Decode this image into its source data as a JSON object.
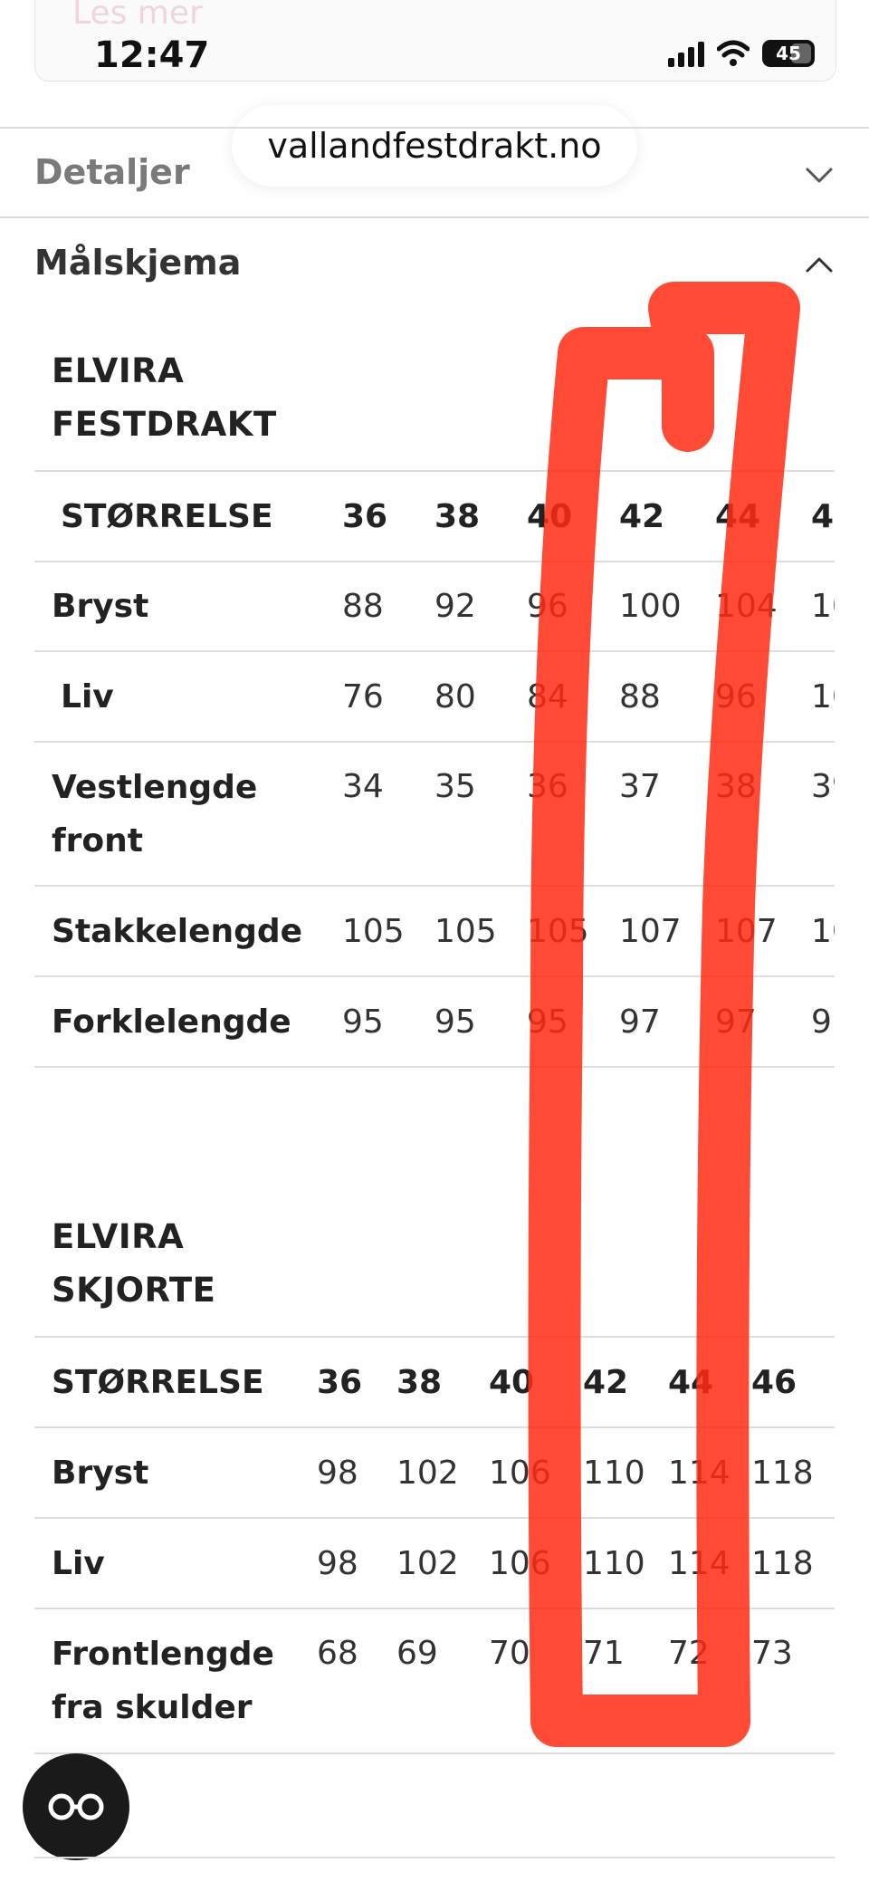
{
  "top": {
    "les_mer": "Les mer"
  },
  "status_bar": {
    "time": "12:47",
    "battery": "45"
  },
  "browser": {
    "url": "vallandfestdrakt.no"
  },
  "accordion": {
    "details_label": "Detaljer",
    "size_chart_label": "Målskjema"
  },
  "festdrakt_table": {
    "title_line1": "ELVIRA",
    "title_line2": "FESTDRAKT",
    "header": [
      "STØRRELSE",
      "36",
      "38",
      "40",
      "42",
      "44",
      "4"
    ],
    "rows": [
      {
        "label": "Bryst",
        "values": [
          "88",
          "92",
          "96",
          "100",
          "104",
          "10"
        ]
      },
      {
        "label": "Liv",
        "values": [
          "76",
          "80",
          "84",
          "88",
          "96",
          "10"
        ]
      },
      {
        "label": "Vestlengde front",
        "values": [
          "34",
          "35",
          "36",
          "37",
          "38",
          "39"
        ]
      },
      {
        "label": "Stakkelengde",
        "values": [
          "105",
          "105",
          "105",
          "107",
          "107",
          "10"
        ]
      },
      {
        "label": "Forklelengde",
        "values": [
          "95",
          "95",
          "95",
          "97",
          "97",
          "9"
        ]
      }
    ]
  },
  "skjorte_table": {
    "title_line1": "ELVIRA",
    "title_line2": "SKJORTE",
    "header": [
      "STØRRELSE",
      "36",
      "38",
      "40",
      "42",
      "44",
      "46"
    ],
    "rows": [
      {
        "label": "Bryst",
        "values": [
          "98",
          "102",
          "106",
          "110",
          "114",
          "118"
        ]
      },
      {
        "label": "Liv",
        "values": [
          "98",
          "102",
          "106",
          "110",
          "114",
          "118"
        ]
      },
      {
        "label": "Frontlengde fra skulder",
        "values": [
          "68",
          "69",
          "70",
          "71",
          "72",
          "73"
        ]
      }
    ]
  },
  "fab": {
    "icon": "glasses-icon"
  },
  "annotation": {
    "color": "#ff2a12"
  }
}
